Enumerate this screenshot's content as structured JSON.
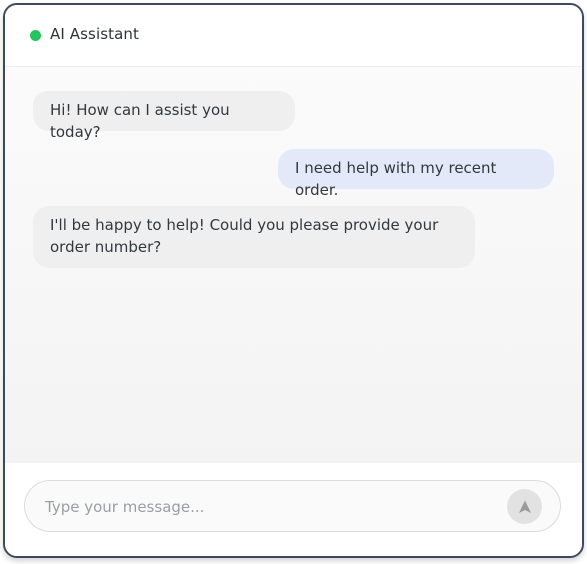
{
  "header": {
    "title": "AI Assistant",
    "status_color": "#22c55e",
    "status": "online"
  },
  "messages": [
    {
      "sender": "assistant",
      "text": "Hi! How can I assist you today?"
    },
    {
      "sender": "user",
      "text": "I need help with my recent order."
    },
    {
      "sender": "assistant",
      "text": "I'll be happy to help! Could you please provide your\norder number?"
    }
  ],
  "composer": {
    "placeholder": "Type your message...",
    "value": "",
    "send_icon": "send-arrow-icon"
  },
  "colors": {
    "assistant_bubble": "#efefef",
    "user_bubble": "#e3e9f9",
    "window_border": "#3d4a5e"
  }
}
